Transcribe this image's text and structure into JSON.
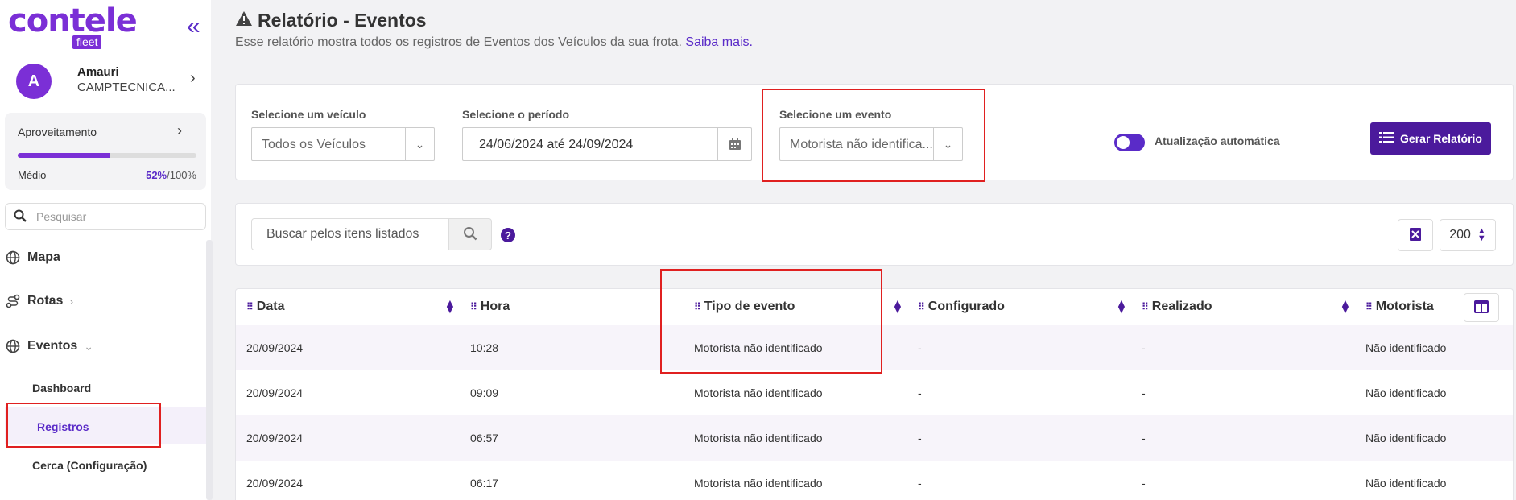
{
  "sidebar": {
    "logo_main": "contele",
    "logo_sub": "fleet",
    "collapse_icon": "«",
    "user": {
      "initial": "A",
      "name": "Amauri",
      "company": "CAMPTECNICA..."
    },
    "aprov": {
      "title": "Aproveitamento",
      "level": "Médio",
      "pct": "52%",
      "total": "/100%",
      "fill": 0.52
    },
    "search_placeholder": "Pesquisar",
    "nav": [
      {
        "label": "Mapa",
        "icon": "globe-icon"
      },
      {
        "label": "Rotas",
        "icon": "route-icon"
      },
      {
        "label": "Eventos",
        "icon": "globe-icon"
      }
    ],
    "sub": [
      "Dashboard",
      "Registros",
      "Cerca (Configuração)"
    ]
  },
  "header": {
    "title": "Relatório - Eventos",
    "desc": "Esse relatório mostra todos os registros de Eventos dos Veículos da sua frota.",
    "link": "Saiba mais."
  },
  "filters": {
    "vehicle_label": "Selecione um veículo",
    "vehicle_value": "Todos os Veículos",
    "period_label": "Selecione o período",
    "period_from": "24/06/2024",
    "period_sep": "até",
    "period_to": "24/09/2024",
    "event_label": "Selecione um evento",
    "event_value": "Motorista não identifica...",
    "auto_update": "Atualização automática",
    "generate": "Gerar Relatório"
  },
  "search": {
    "placeholder": "Buscar pelos itens listados",
    "help": "?",
    "page_size": "200"
  },
  "table": {
    "columns": [
      "Data",
      "Hora",
      "Tipo de evento",
      "Configurado",
      "Realizado",
      "Motorista"
    ],
    "rows": [
      [
        "20/09/2024",
        "10:28",
        "Motorista não identificado",
        "-",
        "-",
        "Não identificado"
      ],
      [
        "20/09/2024",
        "09:09",
        "Motorista não identificado",
        "-",
        "-",
        "Não identificado"
      ],
      [
        "20/09/2024",
        "06:57",
        "Motorista não identificado",
        "-",
        "-",
        "Não identificado"
      ],
      [
        "20/09/2024",
        "06:17",
        "Motorista não identificado",
        "-",
        "-",
        "Não identificado"
      ]
    ]
  },
  "colors": {
    "accent": "#5a2bc8",
    "button": "#4b1a9c",
    "highlight": "#e02020"
  }
}
